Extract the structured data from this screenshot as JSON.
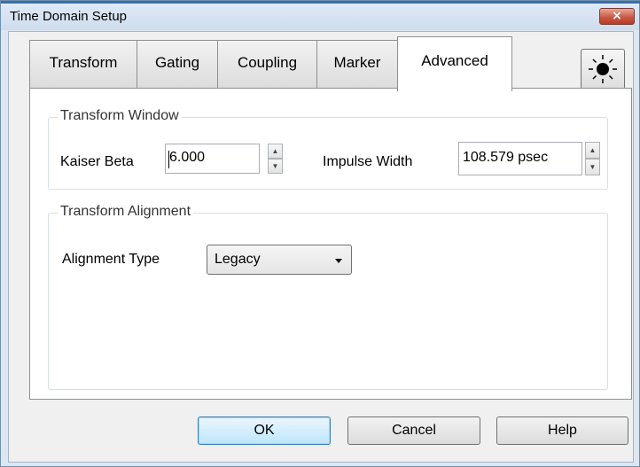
{
  "window": {
    "title": "Time Domain Setup",
    "close_glyph": "×"
  },
  "tabs": [
    {
      "label": "Transform",
      "active": false
    },
    {
      "label": "Gating",
      "active": false
    },
    {
      "label": "Coupling",
      "active": false
    },
    {
      "label": "Marker",
      "active": false
    },
    {
      "label": "Advanced",
      "active": true
    }
  ],
  "toolbar": {
    "brightness_icon": "sun-icon"
  },
  "transform_window": {
    "title": "Transform Window",
    "kaiser_beta_label": "Kaiser Beta",
    "kaiser_beta_value": "6.000",
    "impulse_width_label": "Impulse Width",
    "impulse_width_value": "108.579 psec",
    "spin_up": "▲",
    "spin_down": "▼"
  },
  "transform_alignment": {
    "title": "Transform Alignment",
    "alignment_type_label": "Alignment Type",
    "alignment_type_value": "Legacy"
  },
  "buttons": {
    "ok": "OK",
    "cancel": "Cancel",
    "help": "Help"
  },
  "colors": {
    "title_bar": "#dfeaf7",
    "close_button": "#c95a45",
    "default_button": "#bee6fd",
    "window_border": "#6f8fb0"
  }
}
